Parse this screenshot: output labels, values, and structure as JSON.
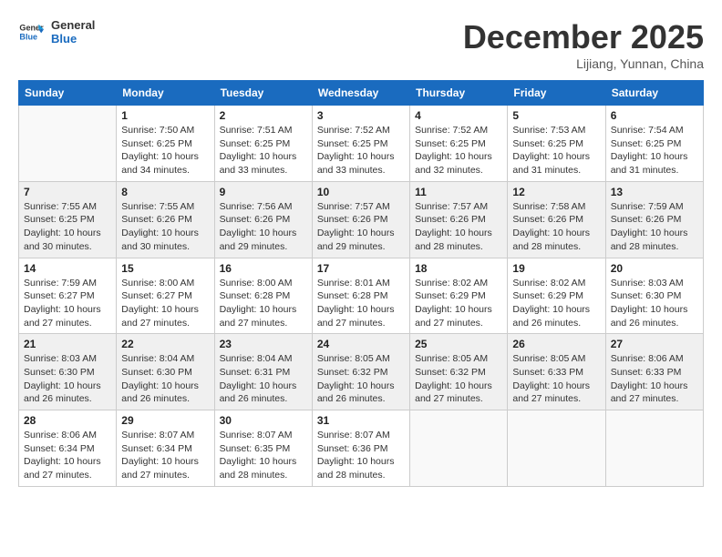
{
  "logo": {
    "line1": "General",
    "line2": "Blue"
  },
  "title": "December 2025",
  "subtitle": "Lijiang, Yunnan, China",
  "weekdays": [
    "Sunday",
    "Monday",
    "Tuesday",
    "Wednesday",
    "Thursday",
    "Friday",
    "Saturday"
  ],
  "weeks": [
    {
      "shaded": false,
      "days": [
        {
          "number": "",
          "info": ""
        },
        {
          "number": "1",
          "info": "Sunrise: 7:50 AM\nSunset: 6:25 PM\nDaylight: 10 hours\nand 34 minutes."
        },
        {
          "number": "2",
          "info": "Sunrise: 7:51 AM\nSunset: 6:25 PM\nDaylight: 10 hours\nand 33 minutes."
        },
        {
          "number": "3",
          "info": "Sunrise: 7:52 AM\nSunset: 6:25 PM\nDaylight: 10 hours\nand 33 minutes."
        },
        {
          "number": "4",
          "info": "Sunrise: 7:52 AM\nSunset: 6:25 PM\nDaylight: 10 hours\nand 32 minutes."
        },
        {
          "number": "5",
          "info": "Sunrise: 7:53 AM\nSunset: 6:25 PM\nDaylight: 10 hours\nand 31 minutes."
        },
        {
          "number": "6",
          "info": "Sunrise: 7:54 AM\nSunset: 6:25 PM\nDaylight: 10 hours\nand 31 minutes."
        }
      ]
    },
    {
      "shaded": true,
      "days": [
        {
          "number": "7",
          "info": "Sunrise: 7:55 AM\nSunset: 6:25 PM\nDaylight: 10 hours\nand 30 minutes."
        },
        {
          "number": "8",
          "info": "Sunrise: 7:55 AM\nSunset: 6:26 PM\nDaylight: 10 hours\nand 30 minutes."
        },
        {
          "number": "9",
          "info": "Sunrise: 7:56 AM\nSunset: 6:26 PM\nDaylight: 10 hours\nand 29 minutes."
        },
        {
          "number": "10",
          "info": "Sunrise: 7:57 AM\nSunset: 6:26 PM\nDaylight: 10 hours\nand 29 minutes."
        },
        {
          "number": "11",
          "info": "Sunrise: 7:57 AM\nSunset: 6:26 PM\nDaylight: 10 hours\nand 28 minutes."
        },
        {
          "number": "12",
          "info": "Sunrise: 7:58 AM\nSunset: 6:26 PM\nDaylight: 10 hours\nand 28 minutes."
        },
        {
          "number": "13",
          "info": "Sunrise: 7:59 AM\nSunset: 6:26 PM\nDaylight: 10 hours\nand 28 minutes."
        }
      ]
    },
    {
      "shaded": false,
      "days": [
        {
          "number": "14",
          "info": "Sunrise: 7:59 AM\nSunset: 6:27 PM\nDaylight: 10 hours\nand 27 minutes."
        },
        {
          "number": "15",
          "info": "Sunrise: 8:00 AM\nSunset: 6:27 PM\nDaylight: 10 hours\nand 27 minutes."
        },
        {
          "number": "16",
          "info": "Sunrise: 8:00 AM\nSunset: 6:28 PM\nDaylight: 10 hours\nand 27 minutes."
        },
        {
          "number": "17",
          "info": "Sunrise: 8:01 AM\nSunset: 6:28 PM\nDaylight: 10 hours\nand 27 minutes."
        },
        {
          "number": "18",
          "info": "Sunrise: 8:02 AM\nSunset: 6:29 PM\nDaylight: 10 hours\nand 27 minutes."
        },
        {
          "number": "19",
          "info": "Sunrise: 8:02 AM\nSunset: 6:29 PM\nDaylight: 10 hours\nand 26 minutes."
        },
        {
          "number": "20",
          "info": "Sunrise: 8:03 AM\nSunset: 6:30 PM\nDaylight: 10 hours\nand 26 minutes."
        }
      ]
    },
    {
      "shaded": true,
      "days": [
        {
          "number": "21",
          "info": "Sunrise: 8:03 AM\nSunset: 6:30 PM\nDaylight: 10 hours\nand 26 minutes."
        },
        {
          "number": "22",
          "info": "Sunrise: 8:04 AM\nSunset: 6:30 PM\nDaylight: 10 hours\nand 26 minutes."
        },
        {
          "number": "23",
          "info": "Sunrise: 8:04 AM\nSunset: 6:31 PM\nDaylight: 10 hours\nand 26 minutes."
        },
        {
          "number": "24",
          "info": "Sunrise: 8:05 AM\nSunset: 6:32 PM\nDaylight: 10 hours\nand 26 minutes."
        },
        {
          "number": "25",
          "info": "Sunrise: 8:05 AM\nSunset: 6:32 PM\nDaylight: 10 hours\nand 27 minutes."
        },
        {
          "number": "26",
          "info": "Sunrise: 8:05 AM\nSunset: 6:33 PM\nDaylight: 10 hours\nand 27 minutes."
        },
        {
          "number": "27",
          "info": "Sunrise: 8:06 AM\nSunset: 6:33 PM\nDaylight: 10 hours\nand 27 minutes."
        }
      ]
    },
    {
      "shaded": false,
      "days": [
        {
          "number": "28",
          "info": "Sunrise: 8:06 AM\nSunset: 6:34 PM\nDaylight: 10 hours\nand 27 minutes."
        },
        {
          "number": "29",
          "info": "Sunrise: 8:07 AM\nSunset: 6:34 PM\nDaylight: 10 hours\nand 27 minutes."
        },
        {
          "number": "30",
          "info": "Sunrise: 8:07 AM\nSunset: 6:35 PM\nDaylight: 10 hours\nand 28 minutes."
        },
        {
          "number": "31",
          "info": "Sunrise: 8:07 AM\nSunset: 6:36 PM\nDaylight: 10 hours\nand 28 minutes."
        },
        {
          "number": "",
          "info": ""
        },
        {
          "number": "",
          "info": ""
        },
        {
          "number": "",
          "info": ""
        }
      ]
    }
  ]
}
